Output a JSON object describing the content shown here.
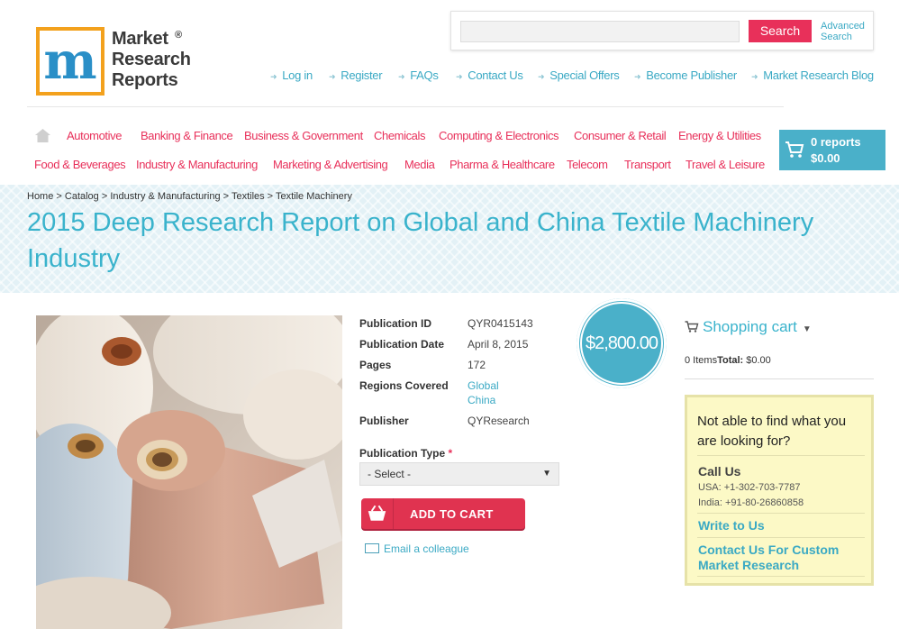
{
  "logo": {
    "text_lines": [
      "Market",
      "Research",
      "Reports"
    ],
    "registered": "®",
    "monogram": "m"
  },
  "search": {
    "placeholder": "",
    "button_label": "Search",
    "advanced_label": "Advanced Search"
  },
  "top_links": [
    "Log in",
    "Register",
    "FAQs",
    "Contact Us",
    "Special Offers",
    "Become Publisher",
    "Market Research Blog"
  ],
  "categories": {
    "row1": [
      "Automotive",
      "Banking & Finance",
      "Business & Government",
      "Chemicals",
      "Computing & Electronics",
      "Consumer & Retail",
      "Energy & Utilities"
    ],
    "row2": [
      "Food & Beverages",
      "Industry & Manufacturing",
      "Marketing & Advertising",
      "Media",
      "Pharma & Healthcare",
      "Telecom",
      "Transport",
      "Travel & Leisure"
    ]
  },
  "header_cart": {
    "reports": "0 reports",
    "total": "$0.00"
  },
  "breadcrumb": "Home > Catalog > Industry & Manufacturing > Textiles > Textile Machinery",
  "title": "2015 Deep Research Report on Global and China Textile Machinery Industry",
  "details": {
    "publication_id_label": "Publication ID",
    "publication_id": "QYR0415143",
    "publication_date_label": "Publication Date",
    "publication_date": "April 8, 2015",
    "pages_label": "Pages",
    "pages": "172",
    "regions_label": "Regions Covered",
    "regions": [
      "Global",
      "China"
    ],
    "publisher_label": "Publisher",
    "publisher": "QYResearch"
  },
  "price": "$2,800.00",
  "publication_type": {
    "label": "Publication Type",
    "required_mark": "*",
    "selected": "- Select -"
  },
  "add_to_cart_label": "ADD TO CART",
  "email_colleague_label": "Email a colleague",
  "sidebar": {
    "shopping_cart_label": "Shopping cart",
    "items_text": "0 Items",
    "total_label": "Total:",
    "total_value": "$0.00",
    "help_title": "Not able to find what you are looking for?",
    "call_us": "Call Us",
    "phone_usa": "USA: +1-302-703-7787",
    "phone_india": "India: +91-80-26860858",
    "write_to_us": "Write to Us",
    "custom_research": "Contact Us For Custom Market Research"
  },
  "colors": {
    "accent_pink": "#e8305a",
    "accent_blue": "#4ab0c9",
    "title_blue": "#3ab3cc",
    "help_bg": "#fcf9c6"
  }
}
